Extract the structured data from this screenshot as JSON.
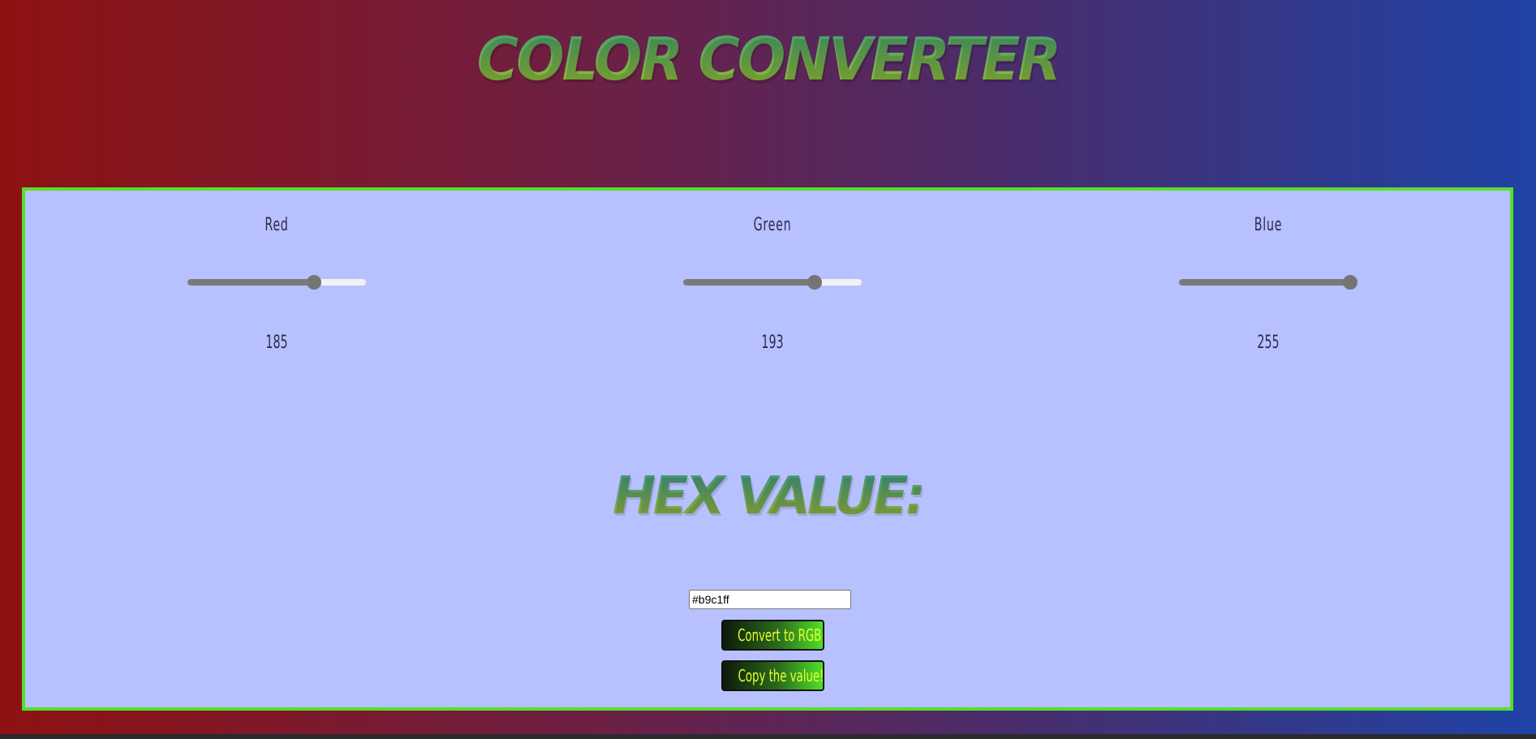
{
  "header": {
    "title": "COLOR CONVERTER"
  },
  "channels": [
    {
      "label": "Red",
      "value": "185",
      "fraction": 0.7255
    },
    {
      "label": "Green",
      "value": "193",
      "fraction": 0.7569
    },
    {
      "label": "Blue",
      "value": "255",
      "fraction": 1.0
    }
  ],
  "hex": {
    "heading": "HEX VALUE:",
    "input_value": "#b9c1ff"
  },
  "buttons": {
    "convert_label": "Convert to RGB",
    "copy_label": "Copy the value!"
  },
  "colors": {
    "panel_background": "#b8c1ff",
    "panel_border": "#56e02a",
    "button_text": "#e7ff2a"
  }
}
